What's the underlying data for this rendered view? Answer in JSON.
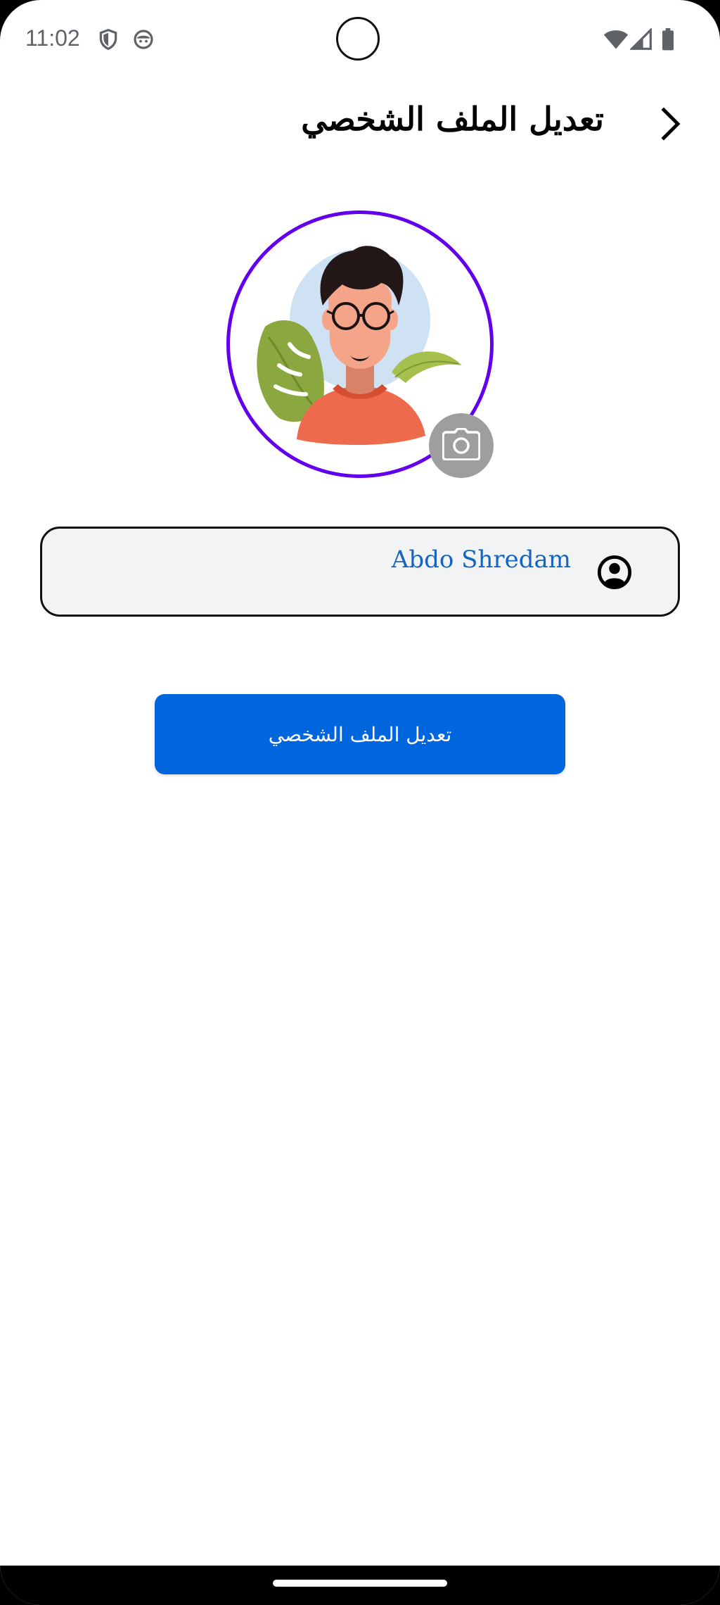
{
  "status_bar": {
    "time": "11:02",
    "left_icons": [
      "shield-icon",
      "android-face-icon"
    ],
    "right_icons": [
      "wifi-icon",
      "cell-signal-icon",
      "battery-icon"
    ]
  },
  "header": {
    "title": "تعديل الملف الشخصي",
    "back_icon": "chevron-right-icon"
  },
  "avatar": {
    "ring_color": "#6200ee",
    "camera_icon": "camera-icon"
  },
  "name_field": {
    "value": "Abdo Shredam",
    "icon": "account-circle-icon"
  },
  "submit": {
    "label": "تعديل الملف الشخصي",
    "color": "#0066dd"
  },
  "colors": {
    "primary": "#0066dd",
    "accent": "#6200ee",
    "field_bg": "#f1f3f5",
    "name_text": "#1565c0"
  }
}
